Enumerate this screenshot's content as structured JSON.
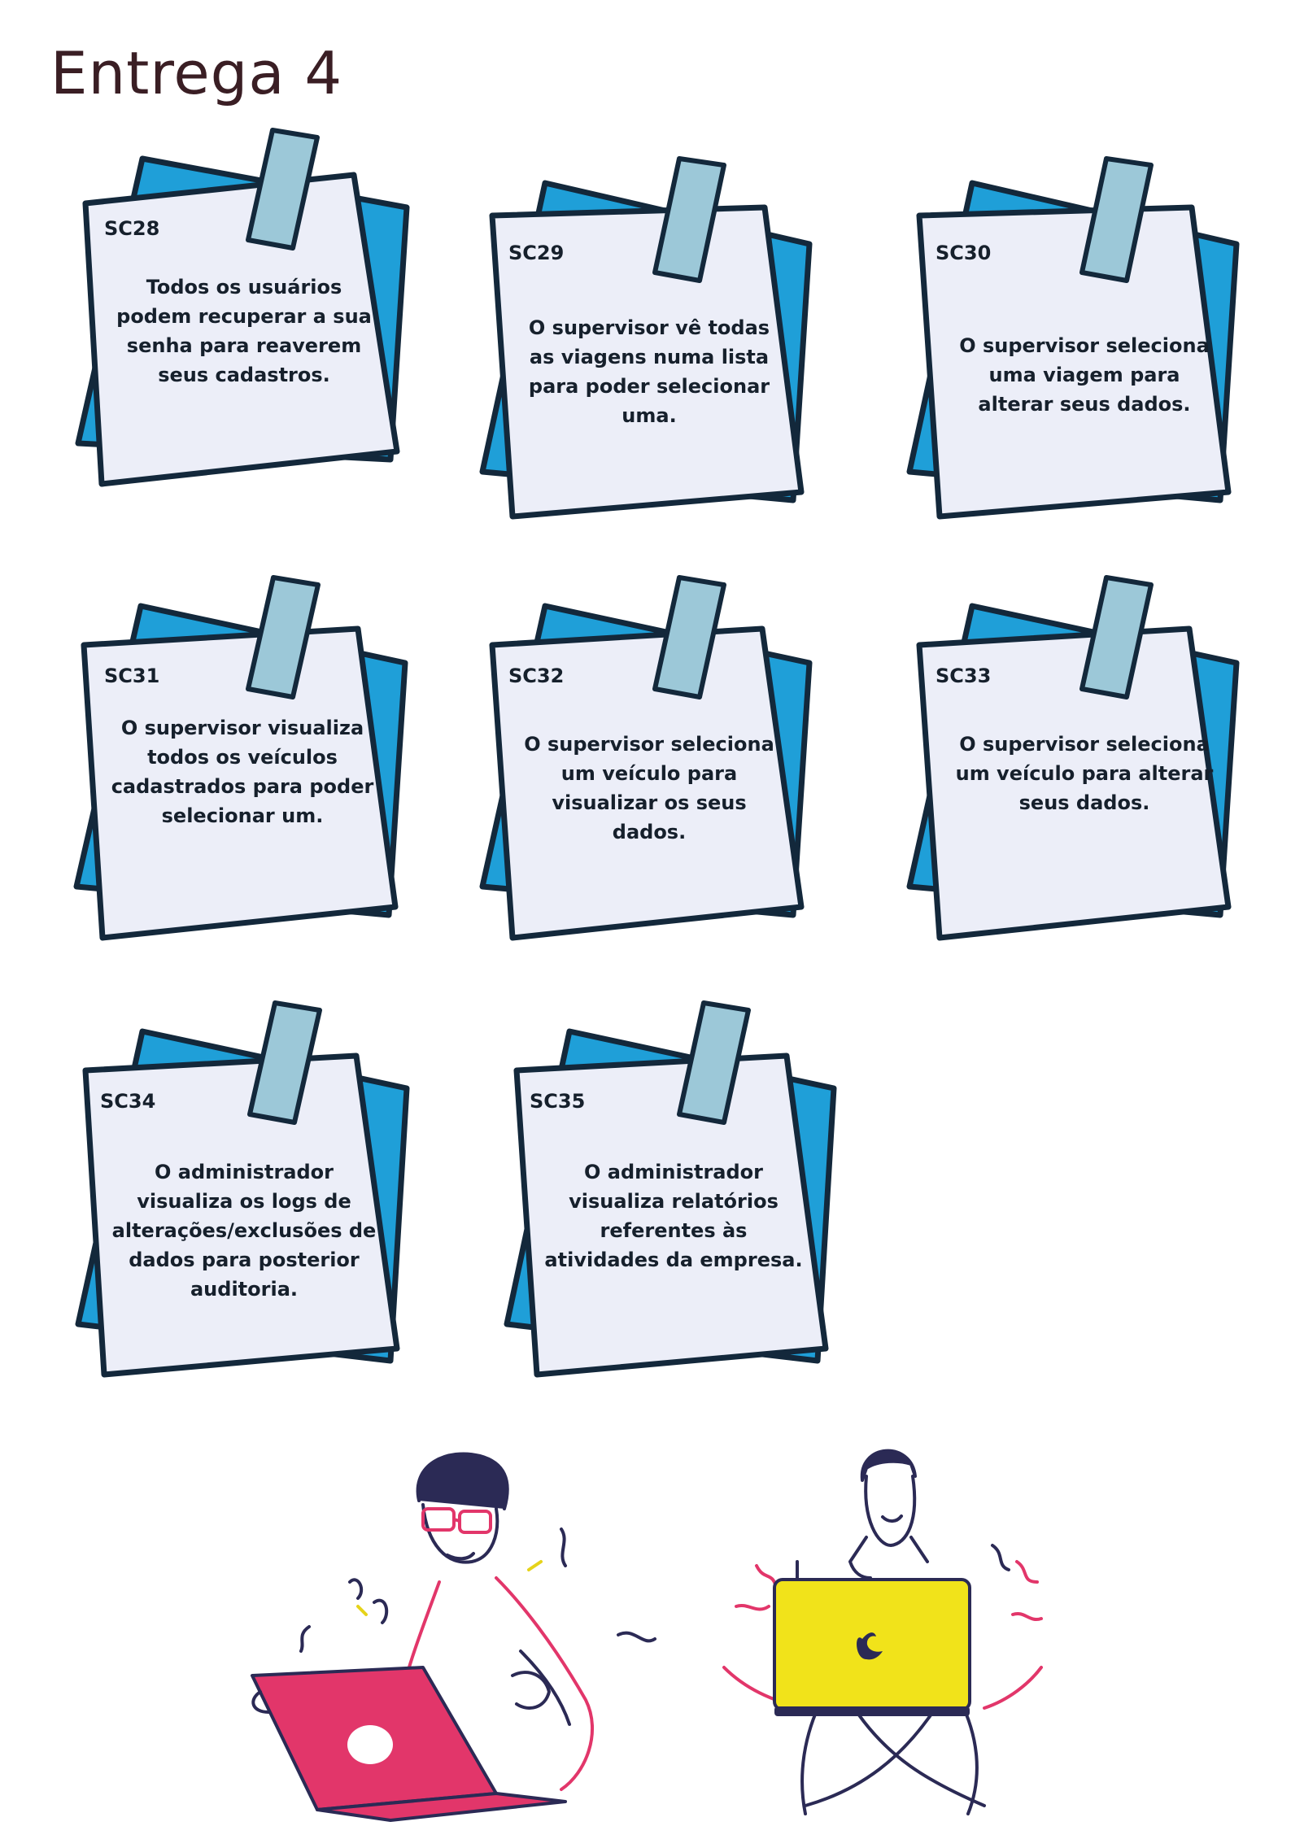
{
  "page": {
    "title": "Entrega 4"
  },
  "colors": {
    "paper": "#eceef8",
    "paper_outline": "#13283b",
    "back_sheet": "#1f9fd8",
    "tape": "#9cc8d8",
    "laptop_red": "#e2366a",
    "laptop_yellow": "#f1e31a",
    "title_text": "#3a1e24"
  },
  "notes": [
    {
      "code": "SC28",
      "text": "Todos os usuários podem recuperar a sua senha para reaverem seus cadastros."
    },
    {
      "code": "SC29",
      "text": "O supervisor vê todas as viagens numa lista para poder selecionar uma."
    },
    {
      "code": "SC30",
      "text": "O supervisor seleciona uma viagem para alterar seus dados."
    },
    {
      "code": "SC31",
      "text": "O supervisor visualiza todos os veículos cadastrados para poder selecionar um."
    },
    {
      "code": "SC32",
      "text": "O supervisor seleciona um veículo para visualizar os seus dados."
    },
    {
      "code": "SC33",
      "text": "O supervisor seleciona um veículo para alterar seus dados."
    },
    {
      "code": "SC34",
      "text": "O administrador visualiza os logs de alterações/exclusões de dados para posterior auditoria."
    },
    {
      "code": "SC35",
      "text": "O administrador visualiza relatórios referentes às atividades da empresa."
    }
  ],
  "icons": {
    "note": "sticky-note-icon",
    "tape": "tape-icon",
    "illustration": "people-with-laptops-illustration"
  }
}
